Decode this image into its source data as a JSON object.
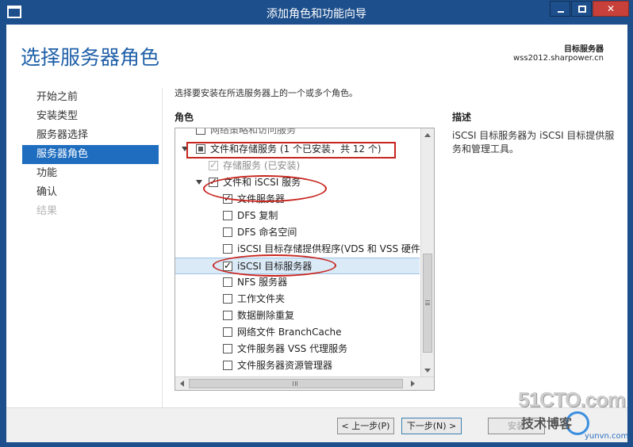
{
  "window": {
    "title": "添加角色和功能向导",
    "minimize": "—",
    "maximize": "□",
    "close": "✕"
  },
  "header": {
    "page_title": "选择服务器角色",
    "dest_label": "目标服务器",
    "dest_server": "wss2012.sharpower.cn"
  },
  "nav": {
    "items": [
      {
        "label": "开始之前",
        "state": "normal"
      },
      {
        "label": "安装类型",
        "state": "normal"
      },
      {
        "label": "服务器选择",
        "state": "normal"
      },
      {
        "label": "服务器角色",
        "state": "active"
      },
      {
        "label": "功能",
        "state": "normal"
      },
      {
        "label": "确认",
        "state": "normal"
      },
      {
        "label": "结果",
        "state": "disabled"
      }
    ]
  },
  "main": {
    "instruction": "选择要安装在所选服务器上的一个或多个角色。",
    "roles_header": "角色",
    "desc_header": "描述",
    "description": "iSCSI 目标服务器为 iSCSI 目标提供服务和管理工具。",
    "tree": [
      {
        "label": "网络策略和访问服务",
        "level": 0,
        "checked": false,
        "clipped": true
      },
      {
        "label": "文件和存储服务 (1 个已安装，共 12 个)",
        "level": 0,
        "checked": "partial",
        "expander": true
      },
      {
        "label": "存储服务 (已安装)",
        "level": 1,
        "checked": true,
        "greyed": true
      },
      {
        "label": "文件和 iSCSI 服务",
        "level": 1,
        "checked": true,
        "expander": true
      },
      {
        "label": "文件服务器",
        "level": 2,
        "checked": true
      },
      {
        "label": "DFS 复制",
        "level": 2,
        "checked": false
      },
      {
        "label": "DFS 命名空间",
        "level": 2,
        "checked": false
      },
      {
        "label": "iSCSI 目标存储提供程序(VDS 和 VSS 硬件提",
        "level": 2,
        "checked": false
      },
      {
        "label": "iSCSI 目标服务器",
        "level": 2,
        "checked": true,
        "selected": true
      },
      {
        "label": "NFS 服务器",
        "level": 2,
        "checked": false
      },
      {
        "label": "工作文件夹",
        "level": 2,
        "checked": false
      },
      {
        "label": "数据删除重复",
        "level": 2,
        "checked": false
      },
      {
        "label": "网络文件 BranchCache",
        "level": 2,
        "checked": false
      },
      {
        "label": "文件服务器 VSS 代理服务",
        "level": 2,
        "checked": false
      },
      {
        "label": "文件服务器资源管理器",
        "level": 2,
        "checked": false
      }
    ]
  },
  "footer": {
    "prev_label": "< 上一步(P)",
    "next_label": "下一步(N) >",
    "install_label": "安装"
  },
  "watermark": {
    "brand": "51CTO.com",
    "tagline": "技术博客",
    "site": "yunvn.com"
  },
  "colors": {
    "titlebar": "#1d4f8c",
    "accent": "#1f6dbf",
    "page_title": "#1e5fa8",
    "annotation": "#c8241e"
  }
}
